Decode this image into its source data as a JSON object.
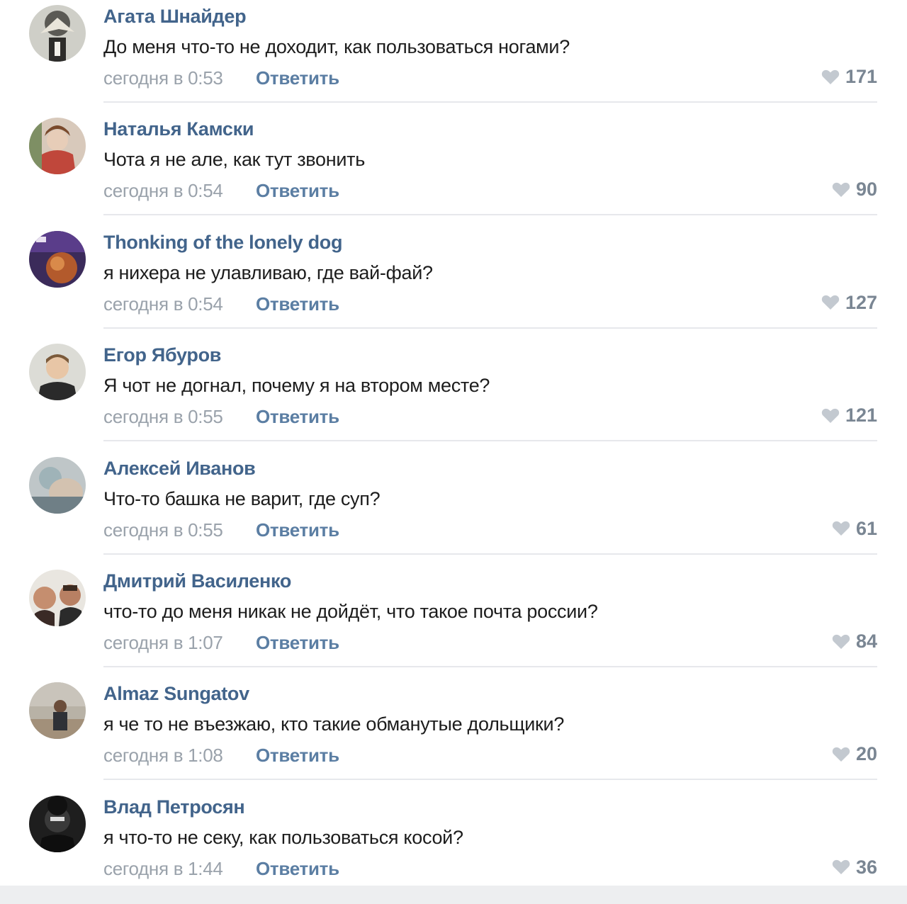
{
  "comments": [
    {
      "author": "Агата Шнайдер",
      "text": "До меня что-то не доходит, как пользоваться ногами?",
      "date": "сегодня в 0:53",
      "reply_label": "Ответить",
      "likes": "171"
    },
    {
      "author": "Наталья Камски",
      "text": "Чота я не але, как тут звонить",
      "date": "сегодня в 0:54",
      "reply_label": "Ответить",
      "likes": "90"
    },
    {
      "author": "Thonking of the lonely dog",
      "text": "я нихера не улавливаю, где вай-фай?",
      "date": "сегодня в 0:54",
      "reply_label": "Ответить",
      "likes": "127"
    },
    {
      "author": "Егор Ябуров",
      "text": "Я чот не догнал, почему я на втором месте?",
      "date": "сегодня в 0:55",
      "reply_label": "Ответить",
      "likes": "121"
    },
    {
      "author": "Алексей Иванов",
      "text": "Что-то башка не варит, где суп?",
      "date": "сегодня в 0:55",
      "reply_label": "Ответить",
      "likes": "61"
    },
    {
      "author": "Дмитрий Василенко",
      "text": "что-то до меня никак не дойдёт, что такое почта россии?",
      "date": "сегодня в 1:07",
      "reply_label": "Ответить",
      "likes": "84"
    },
    {
      "author": "Almaz Sungatov",
      "text": "я че то не въезжаю, кто такие обманутые дольщики?",
      "date": "сегодня в 1:08",
      "reply_label": "Ответить",
      "likes": "20"
    },
    {
      "author": "Влад Петросян",
      "text": "я что-то не секу, как пользоваться косой?",
      "date": "сегодня в 1:44",
      "reply_label": "Ответить",
      "likes": "36"
    }
  ],
  "colors": {
    "author": "#42648b",
    "reply": "#5b7ea3",
    "date": "#9aa2ab",
    "heart": "#c3c9d0",
    "likes": "#7a8693"
  },
  "icons": {
    "like": "heart-icon"
  }
}
